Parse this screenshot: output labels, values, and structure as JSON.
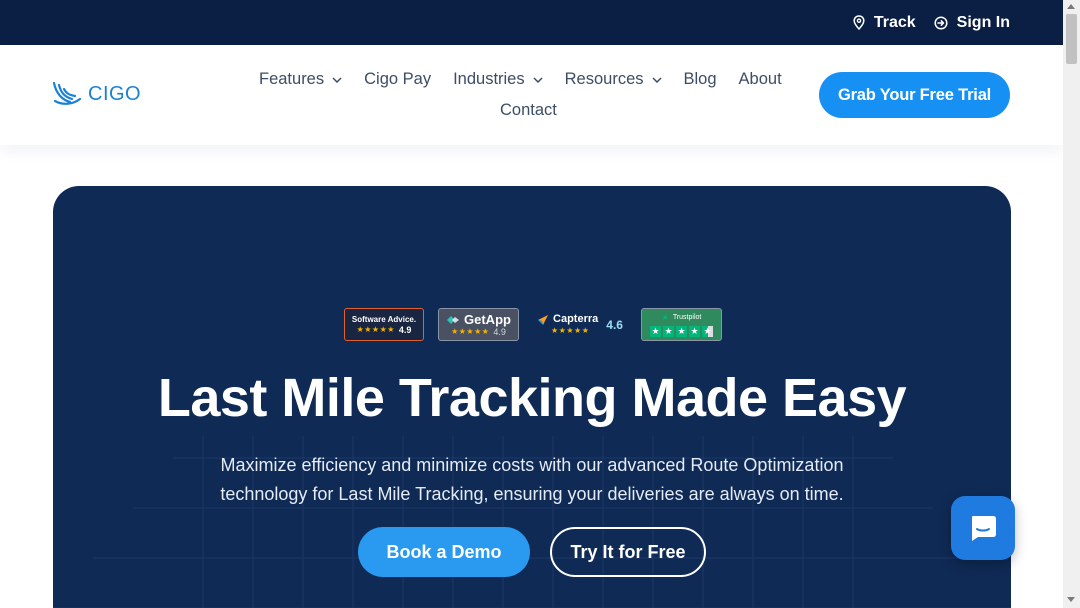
{
  "topbar": {
    "track_label": "Track",
    "signin_label": "Sign In"
  },
  "header": {
    "logo_text": "CIGO",
    "nav": {
      "features": "Features",
      "cigo_pay": "Cigo Pay",
      "industries": "Industries",
      "resources": "Resources",
      "blog": "Blog",
      "about": "About",
      "contact": "Contact"
    },
    "cta_label": "Grab Your Free Trial"
  },
  "badges": {
    "software_advice": {
      "name": "Software Advice.",
      "score": "4.9"
    },
    "getapp": {
      "name": "GetApp",
      "score": "4.9"
    },
    "capterra": {
      "name": "Capterra",
      "score": "4.6"
    },
    "trustpilot": {
      "name": "Trustpilot"
    }
  },
  "hero": {
    "title": "Last Mile Tracking Made Easy",
    "subtitle_line1": "Maximize efficiency and minimize costs with our advanced Route Optimization",
    "subtitle_line2": "technology for Last Mile Tracking, ensuring your deliveries are always on time.",
    "demo_label": "Book a Demo",
    "free_label": "Try It for Free"
  },
  "icons": {
    "track": "map-pin-icon",
    "signin": "sign-in-icon",
    "chat": "chat-bubble-icon"
  },
  "colors": {
    "topbar_bg": "#0b1f45",
    "hero_bg": "#0f2a55",
    "accent": "#1790f3",
    "logo": "#1a82d6"
  }
}
